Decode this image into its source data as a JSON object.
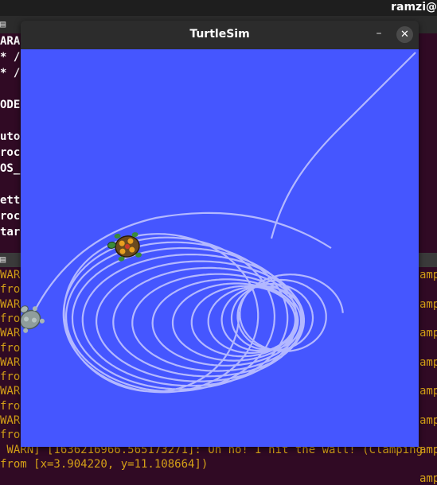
{
  "top_panel": {
    "user": "ramzi@"
  },
  "term_upper": {
    "lines": [
      "ARA",
      "* /",
      "* /",
      "",
      "ODE",
      "",
      "uto",
      "roc",
      "OS_",
      "",
      "ett",
      "roc",
      "tar"
    ]
  },
  "term_lower": {
    "lines": [
      "WAR",
      "from",
      "WAR",
      "from",
      "WAR",
      "from",
      "WAR",
      "from",
      "WAR",
      "from",
      "WAR",
      "from",
      " WARN] [1636216966.565173271]: Oh no! I hit the wall! (Clamping",
      "from [x=3.904220, y=11.108664])"
    ],
    "right_edge": [
      "ampi",
      "ampi",
      "ampi",
      "ampi",
      "ampi",
      "ampi",
      "ampi",
      "ampi"
    ]
  },
  "turtlesim": {
    "title": "TurtleSim",
    "minimize_label": "–",
    "close_label": "✕",
    "colors": {
      "background": "#4556ff",
      "pen": "#b3b8ff"
    }
  }
}
